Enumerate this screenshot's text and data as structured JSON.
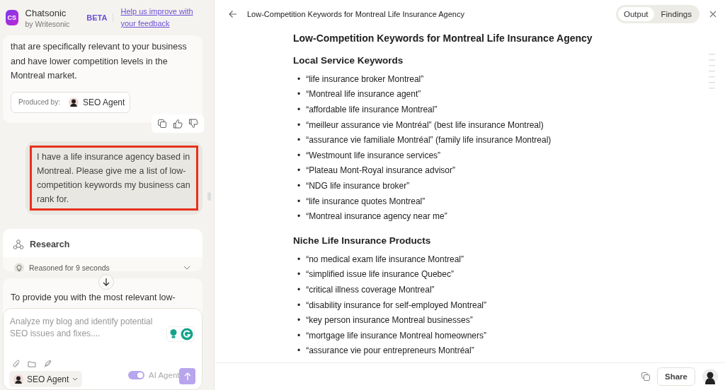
{
  "app": {
    "logo_text": "CS",
    "name": "Chatsonic",
    "byline": "by Writesonic",
    "badge": "BETA",
    "feedback_link": "Help us improve with your feedback"
  },
  "chat": {
    "assistant_text": "that are specifically relevant to your business and have lower competition levels in the Montreal market.",
    "produced_by_label": "Produced by:",
    "produced_by_agent": "SEO Agent",
    "user_message": "I have a life insurance agency based in Montreal. Please give me a list of low-competition keywords my business can rank for.",
    "user_message_highlighted": true,
    "research": {
      "title": "Research",
      "status": "Reasoned for 9 seconds",
      "expanded": false
    },
    "reply_start": "To provide you with the most relevant low-"
  },
  "composer": {
    "placeholder": "Analyze my blog and identify potential SEO issues and fixes....",
    "agent": "SEO Agent",
    "ai_agent": {
      "label": "AI Agent",
      "on": true
    }
  },
  "document": {
    "title": "Low-Competition Keywords for Montreal Life Insurance Agency",
    "tabs": [
      {
        "label": "Output",
        "selected": true
      },
      {
        "label": "Findings",
        "selected": false
      }
    ],
    "heading": "Low-Competition Keywords for Montreal Life Insurance Agency",
    "sections": [
      {
        "heading": "Local Service Keywords",
        "items": [
          "“life insurance broker Montreal”",
          "“Montreal life insurance agent”",
          "“affordable life insurance Montreal”",
          "“meilleur assurance vie Montréal” (best life insurance Montreal)",
          "“assurance vie familiale Montréal” (family life insurance Montreal)",
          "“Westmount life insurance services”",
          "“Plateau Mont-Royal insurance advisor”",
          "“NDG life insurance broker”",
          "“life insurance quotes Montreal”",
          "“Montreal insurance agency near me”"
        ]
      },
      {
        "heading": "Niche Life Insurance Products",
        "items": [
          "“no medical exam life insurance Montreal”",
          "“simplified issue life insurance Quebec”",
          "“critical illness coverage Montreal”",
          "“disability insurance for self-employed Montreal”",
          "“key person insurance Montreal businesses”",
          "“mortgage life insurance Montreal homeowners”",
          "“assurance vie pour entrepreneurs Montréal”"
        ]
      }
    ],
    "bullet": "•",
    "share": "Share"
  }
}
